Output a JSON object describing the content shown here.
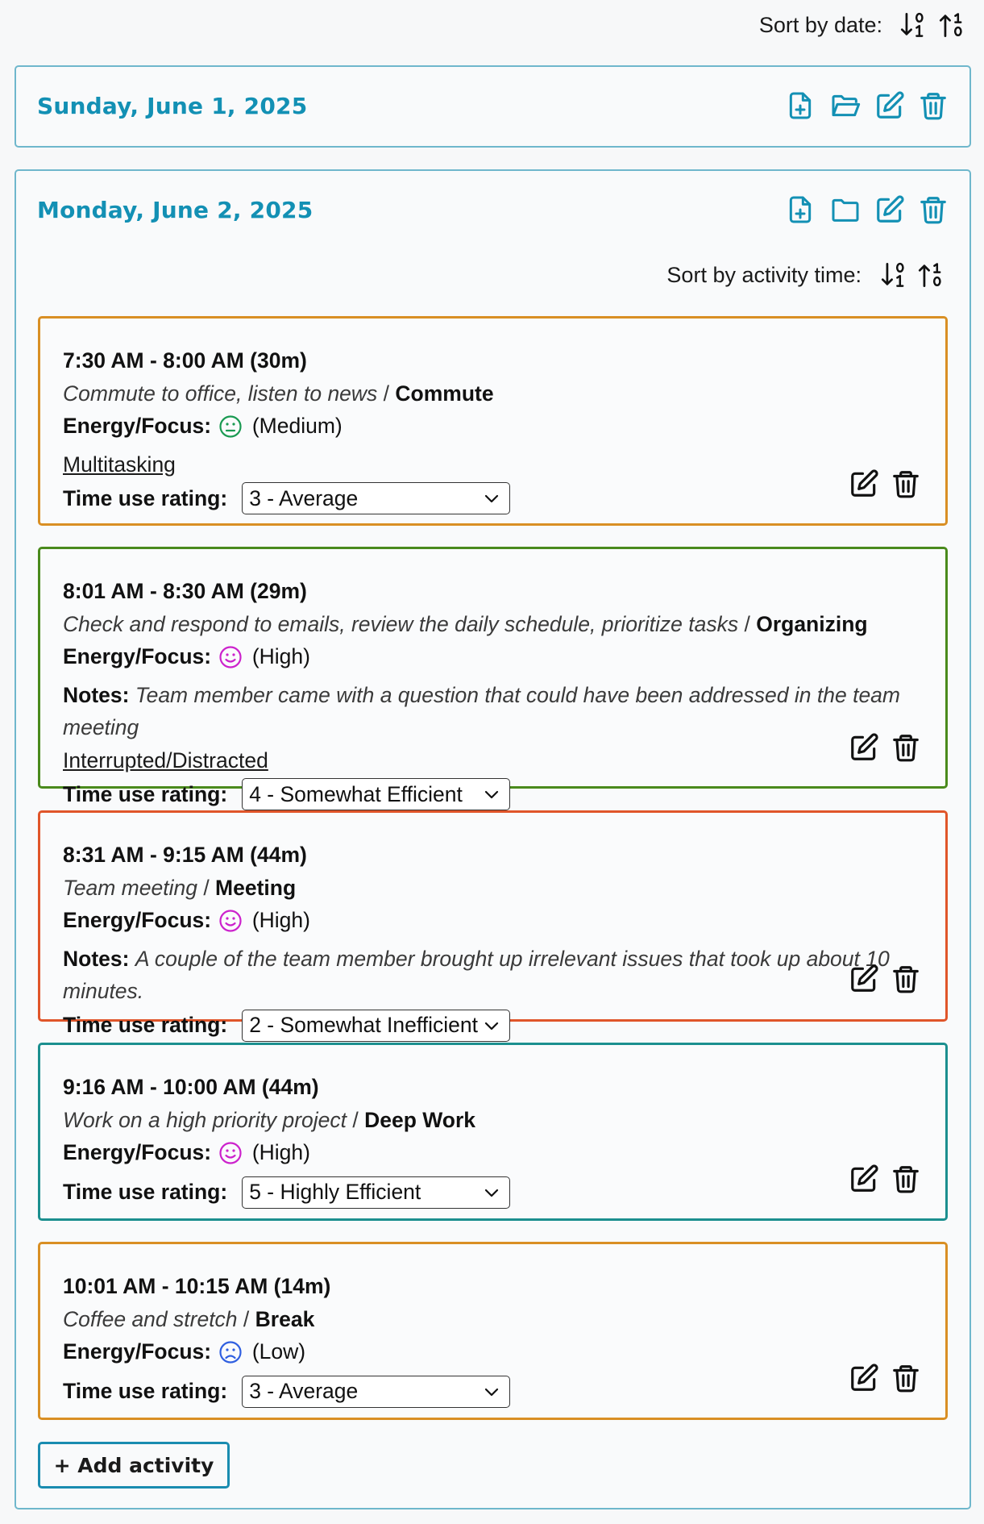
{
  "sort_by_date_label": "Sort by date:",
  "sort_by_activity_label": "Sort by activity time:",
  "energy_label": "Energy/Focus:",
  "notes_label": "Notes:",
  "rating_label": "Time use rating:",
  "colors": {
    "accent": "#1390b4",
    "commute_border": "#d98f24",
    "organizing_border": "#4a8a1c",
    "meeting_border": "#e0552a",
    "deepwork_border": "#1b8f8f",
    "break_border": "#d98f24",
    "face_medium": "#1a9a52",
    "face_high": "#cc22cc",
    "face_low": "#2f5fe0"
  },
  "days": [
    {
      "title": "Sunday, June 1, 2025"
    },
    {
      "title": "Monday, June 2, 2025"
    }
  ],
  "activities": [
    {
      "time": "7:30 AM - 8:00 AM (30m)",
      "description": "Commute to office, listen to news",
      "category": "Commute",
      "energy_icon": "neutral-face-icon",
      "energy": "(Medium)",
      "notes": "",
      "tag": "Multitasking",
      "rating": "3 - Average"
    },
    {
      "time": "8:01 AM - 8:30 AM (29m)",
      "description": "Check and respond to emails, review the daily schedule, prioritize tasks",
      "category": "Organizing",
      "energy_icon": "smiley-face-icon",
      "energy": "(High)",
      "notes": "Team member came with a question that could have been addressed in the team meeting",
      "tag": "Interrupted/Distracted",
      "rating": "4 - Somewhat Efficient"
    },
    {
      "time": "8:31 AM - 9:15 AM (44m)",
      "description": "Team meeting",
      "category": "Meeting",
      "energy_icon": "smiley-face-icon",
      "energy": "(High)",
      "notes": "A couple of the team member brought up irrelevant issues that took up about 10 minutes.",
      "tag": "",
      "rating": "2 - Somewhat Inefficient"
    },
    {
      "time": "9:16 AM - 10:00 AM (44m)",
      "description": "Work on a high priority project",
      "category": "Deep Work",
      "energy_icon": "smiley-face-icon",
      "energy": "(High)",
      "notes": "",
      "tag": "",
      "rating": "5 - Highly Efficient"
    },
    {
      "time": "10:01 AM - 10:15 AM (14m)",
      "description": "Coffee and stretch",
      "category": "Break",
      "energy_icon": "frown-face-icon",
      "energy": "(Low)",
      "notes": "",
      "tag": "",
      "rating": "3 - Average"
    }
  ],
  "add_activity_label": "+ Add activity"
}
